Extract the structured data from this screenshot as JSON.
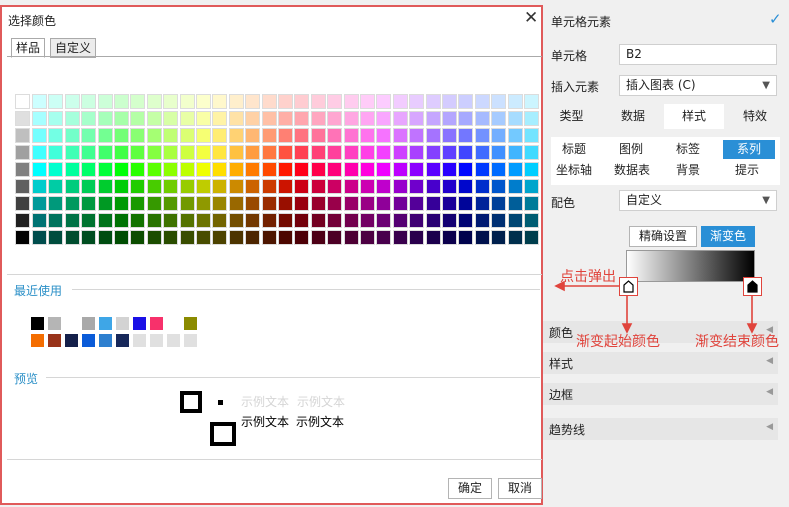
{
  "dialog": {
    "title": "选择颜色",
    "tabs": [
      "样品",
      "自定义"
    ],
    "recent_label": "最近使用",
    "preview_label": "预览",
    "sample_text": "示例文本",
    "ok_label": "确定",
    "cancel_label": "取消",
    "recent_colors": [
      [
        "#000000",
        "#b5b5b5",
        "#ffffff",
        "#a9a9a9",
        "#3ea6e7",
        "#d3d3d3",
        "#1a10e6",
        "#f7316b",
        "#ffffff",
        "#8b8b00"
      ],
      [
        "#f46d00",
        "#99331a",
        "#14204a",
        "#0a5bd8",
        "#2d7fcf",
        "#17285a",
        "#e0e0e0",
        "#e0e0e0",
        "#e0e0e0",
        "#e0e0e0"
      ]
    ]
  },
  "panel": {
    "header": "单元格元素",
    "cell_label": "单元格",
    "cell_value": "B2",
    "insert_label": "插入元素",
    "insert_value": "插入图表 (C)",
    "main_tabs": [
      "类型",
      "数据",
      "样式",
      "特效"
    ],
    "sub_tabs_row1": [
      "标题",
      "图例",
      "标签",
      "系列"
    ],
    "sub_tabs_row2": [
      "坐标轴",
      "数据表",
      "背景",
      "提示"
    ],
    "color_scheme_label": "配色",
    "color_scheme_value": "自定义",
    "precise_label": "精确设置",
    "gradient_label": "渐变色",
    "sections": [
      "颜色",
      "样式",
      "边框",
      "趋势线"
    ]
  },
  "annotations": {
    "popup": "点击弹出",
    "start": "渐变起始颜色",
    "end": "渐变结束颜色"
  },
  "colors": {
    "accent": "#2a8fd6",
    "annotation": "#e0443c",
    "section_title": "#2a8fc7"
  }
}
